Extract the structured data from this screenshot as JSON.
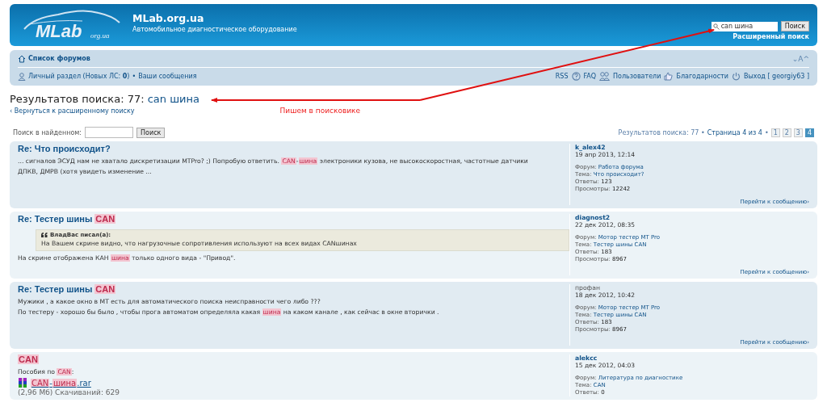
{
  "header": {
    "logo_text": "MLab",
    "logo_suffix": "org.ua",
    "site_title": "MLab.org.ua",
    "site_description": "Автомобильное диагностическое оборудование",
    "search": {
      "value": "can шина",
      "button": "Поиск"
    },
    "advanced_search": "Расширенный поиск"
  },
  "navbar": {
    "forum_index": "Список форумов",
    "font_size": "⌄A^",
    "user_links": [
      {
        "text": "Личный раздел (Новых ЛС: ",
        "count": "0",
        "suffix": ")"
      },
      {
        "separator": "•",
        "text": "Ваши сообщения"
      }
    ],
    "right_links": [
      {
        "kind": "rss",
        "text": "RSS"
      },
      {
        "kind": "faq",
        "text": "FAQ"
      },
      {
        "kind": "users",
        "text": "Пользователи"
      },
      {
        "kind": "thanks",
        "text": "Благодарности"
      },
      {
        "kind": "logout",
        "text": "Выход [ georgiy63 ]"
      }
    ]
  },
  "heading": {
    "label": "Результатов поиска: 77: ",
    "query": "can шина"
  },
  "back_link": "‹ Вернуться к расширенному поиску",
  "annotation": "Пишем в поисковике",
  "search_within": {
    "label": "Поиск в найденном:",
    "button": "Поиск"
  },
  "pagination": {
    "summary": "Результатов поиска: 77 •",
    "page_info": "Страница 4 из 4",
    "separator": "•",
    "pages": [
      {
        "label": "1",
        "selected": false
      },
      {
        "label": "2",
        "selected": false
      },
      {
        "label": "3",
        "selected": false
      },
      {
        "label": "4",
        "selected": true
      }
    ]
  },
  "posts": [
    {
      "title": [
        {
          "text": "Re: Что происходит?",
          "highlight": false
        }
      ],
      "body": [
        [
          {
            "text": "... сигналов ЭСУД нам не хватало дискретизации MTPro? ;) Попробую ответить. ",
            "highlight": false
          },
          {
            "text": "CAN",
            "highlight": true
          },
          {
            "text": "-",
            "highlight": false
          },
          {
            "text": "шина",
            "highlight": true
          },
          {
            "text": " электроники кузова, не высокоскоростная, частотные датчики",
            "highlight": false
          }
        ],
        [
          {
            "text": "ДПКВ, ДМРВ (хотя увидеть изменение ...",
            "highlight": false
          }
        ]
      ],
      "author": {
        "name": "k_alex42",
        "kind": "user"
      },
      "date": "19 апр 2013, 12:14",
      "meta": [
        {
          "label": "Форум:",
          "value": "Работа форума",
          "kind": "link"
        },
        {
          "label": "Тема:",
          "value": "Что происходит?",
          "kind": "link"
        },
        {
          "label": "Ответы:",
          "value": "123",
          "kind": "count"
        },
        {
          "label": "Просмотры:",
          "value": "12242",
          "kind": "count"
        }
      ],
      "jump": "Перейти к сообщению›"
    },
    {
      "title": [
        {
          "text": "Re: Тестер шины ",
          "highlight": false
        },
        {
          "text": "CAN",
          "highlight": true
        }
      ],
      "quote": {
        "author": "ВладВас писал(а):",
        "text": "На Вашем скрине видно, что нагрузочные сопротивления используют на всех видах CANшинах"
      },
      "body": [
        [
          {
            "text": "На скрине отображена КАН ",
            "highlight": false
          },
          {
            "text": "шина",
            "highlight": true
          },
          {
            "text": " только одного вида - \"Привод\".",
            "highlight": false
          }
        ]
      ],
      "author": {
        "name": "diagnost2",
        "kind": "user"
      },
      "date": "22 дек 2012, 08:35",
      "meta": [
        {
          "label": "Форум:",
          "value": "Мотор тестер MT Pro",
          "kind": "link"
        },
        {
          "label": "Тема:",
          "value": "Тестер шины CAN",
          "kind": "link"
        },
        {
          "label": "Ответы:",
          "value": "183",
          "kind": "count"
        },
        {
          "label": "Просмотры:",
          "value": "8967",
          "kind": "count"
        }
      ],
      "jump": "Перейти к сообщению›"
    },
    {
      "title": [
        {
          "text": "Re: Тестер шины ",
          "highlight": false
        },
        {
          "text": "CAN",
          "highlight": true
        }
      ],
      "body": [
        [
          {
            "text": "Мужики , а какое окно в МТ есть для автоматического поиска неисправности чего либо ???",
            "highlight": false
          }
        ],
        [
          {
            "text": "По тестеру - хорошо бы было , чтобы прога автоматом определяла какая ",
            "highlight": false
          },
          {
            "text": "шина",
            "highlight": true
          },
          {
            "text": " на каком канале , как сейчас в окне вторички .",
            "highlight": false
          }
        ]
      ],
      "author": {
        "name": "профан",
        "kind": "guest"
      },
      "date": "18 дек 2012, 10:42",
      "meta": [
        {
          "label": "Форум:",
          "value": "Мотор тестер MT Pro",
          "kind": "link"
        },
        {
          "label": "Тема:",
          "value": "Тестер шины CAN",
          "kind": "link"
        },
        {
          "label": "Ответы:",
          "value": "183",
          "kind": "count"
        },
        {
          "label": "Просмотры:",
          "value": "8967",
          "kind": "count"
        }
      ],
      "jump": "Перейти к сообщению›"
    },
    {
      "title": [
        {
          "text": "CAN",
          "highlight": true
        }
      ],
      "body": [
        [
          {
            "text": "Пособия по ",
            "highlight": false
          },
          {
            "text": "CAN",
            "highlight": true
          },
          {
            "text": ":",
            "highlight": false
          }
        ]
      ],
      "attachment": {
        "name": [
          {
            "text": "CAN",
            "highlight": true
          },
          {
            "text": "-",
            "highlight": false
          },
          {
            "text": "шина",
            "highlight": true
          },
          {
            "text": ".rar",
            "highlight": false
          }
        ],
        "info": "(2,96 Мб) Скачиваний: 629"
      },
      "author": {
        "name": "alekcc",
        "kind": "user"
      },
      "date": "15 дек 2012, 04:03",
      "meta": [
        {
          "label": "Форум:",
          "value": "Литература по диагностике",
          "kind": "link"
        },
        {
          "label": "Тема:",
          "value": "CAN",
          "kind": "link"
        },
        {
          "label": "Ответы:",
          "value": "0",
          "kind": "count"
        }
      ]
    }
  ]
}
